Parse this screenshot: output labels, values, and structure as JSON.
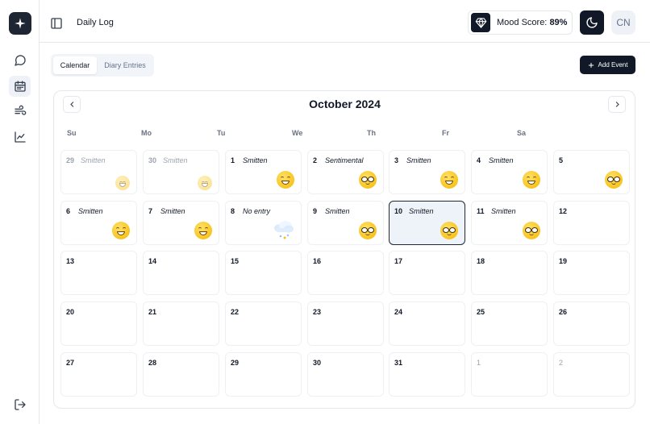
{
  "header": {
    "title": "Daily Log",
    "mood_label": "Mood Score:",
    "mood_value": "89%",
    "avatar": "CN"
  },
  "sidebar": {
    "items": [
      {
        "name": "chat",
        "icon": "message-circle-icon"
      },
      {
        "name": "calendar",
        "icon": "calendar-icon",
        "active": true
      },
      {
        "name": "wind",
        "icon": "wind-icon"
      },
      {
        "name": "chart",
        "icon": "line-chart-icon"
      }
    ],
    "logout_icon": "logout-icon"
  },
  "tabs": [
    {
      "label": "Calendar",
      "active": true
    },
    {
      "label": "Diary Entries",
      "active": false
    }
  ],
  "add_event_label": "Add Event",
  "calendar": {
    "month_title": "October 2024",
    "weekdays": [
      "Su",
      "Mo",
      "Tu",
      "We",
      "Th",
      "Fr",
      "Sa"
    ],
    "weeks": [
      [
        {
          "day": "29",
          "mood": "Smitten",
          "emoji": "grin",
          "other": true
        },
        {
          "day": "30",
          "mood": "Smitten",
          "emoji": "grin",
          "other": true
        },
        {
          "day": "1",
          "mood": "Smitten",
          "emoji": "grin"
        },
        {
          "day": "2",
          "mood": "Sentimental",
          "emoji": "glasses"
        },
        {
          "day": "3",
          "mood": "Smitten",
          "emoji": "grin"
        },
        {
          "day": "4",
          "mood": "Smitten",
          "emoji": "grin"
        },
        {
          "day": "5",
          "mood": "",
          "emoji": "glasses"
        }
      ],
      [
        {
          "day": "6",
          "mood": "Smitten",
          "emoji": "grin"
        },
        {
          "day": "7",
          "mood": "Smitten",
          "emoji": "grin"
        },
        {
          "day": "8",
          "mood": "No entry",
          "emoji": "cloud"
        },
        {
          "day": "9",
          "mood": "Smitten",
          "emoji": "glasses"
        },
        {
          "day": "10",
          "mood": "Smitten",
          "emoji": "glasses",
          "selected": true
        },
        {
          "day": "11",
          "mood": "Smitten",
          "emoji": "glasses"
        },
        {
          "day": "12",
          "mood": "",
          "emoji": ""
        }
      ],
      [
        {
          "day": "13"
        },
        {
          "day": "14"
        },
        {
          "day": "15"
        },
        {
          "day": "16"
        },
        {
          "day": "17"
        },
        {
          "day": "18"
        },
        {
          "day": "19"
        }
      ],
      [
        {
          "day": "20"
        },
        {
          "day": "21"
        },
        {
          "day": "22"
        },
        {
          "day": "23"
        },
        {
          "day": "24"
        },
        {
          "day": "25"
        },
        {
          "day": "26"
        }
      ],
      [
        {
          "day": "27"
        },
        {
          "day": "28"
        },
        {
          "day": "29"
        },
        {
          "day": "30"
        },
        {
          "day": "31"
        },
        {
          "day": "1",
          "next": true
        },
        {
          "day": "2",
          "next": true
        }
      ]
    ]
  },
  "colors": {
    "primary": "#111827",
    "border": "#e5e7eb",
    "muted": "#6b7280",
    "selected_bg": "#eef3f9"
  }
}
